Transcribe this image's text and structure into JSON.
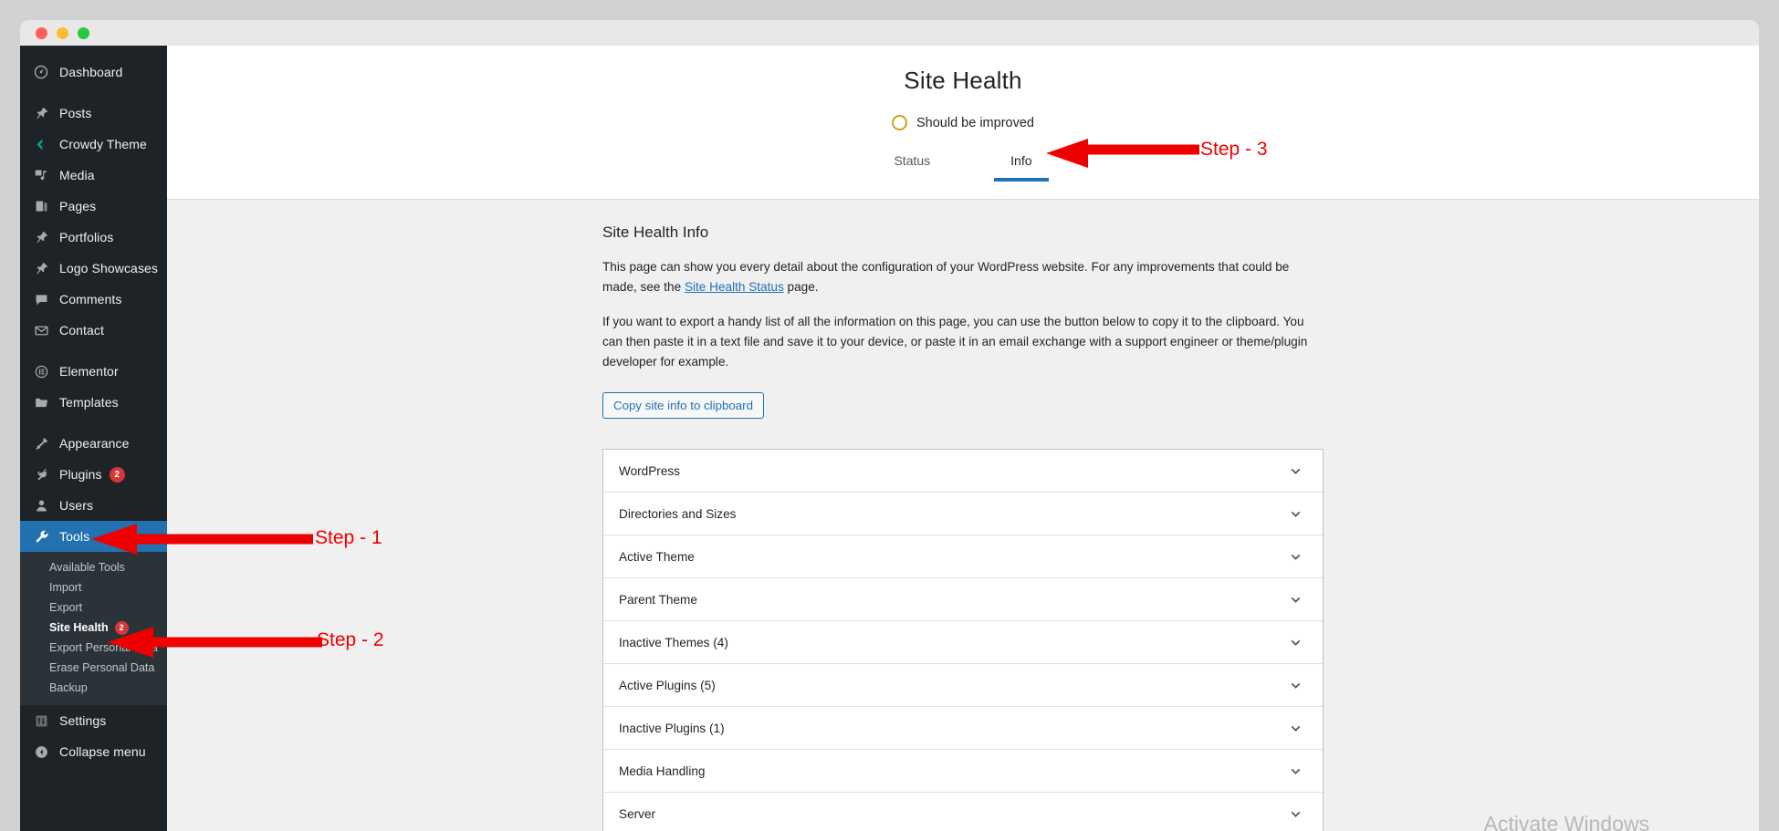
{
  "window": {
    "traffic_lights": [
      "close",
      "minimize",
      "maximize"
    ]
  },
  "sidebar": {
    "items": [
      {
        "label": "Dashboard",
        "icon": "dashboard-icon",
        "badge": null,
        "active": false,
        "spacer_before": false
      },
      {
        "label": "Posts",
        "icon": "pin-icon",
        "badge": null,
        "active": false,
        "spacer_before": true
      },
      {
        "label": "Crowdy Theme",
        "icon": "crowdy-theme-icon",
        "badge": null,
        "active": false,
        "spacer_before": false
      },
      {
        "label": "Media",
        "icon": "media-icon",
        "badge": null,
        "active": false,
        "spacer_before": false
      },
      {
        "label": "Pages",
        "icon": "pages-icon",
        "badge": null,
        "active": false,
        "spacer_before": false
      },
      {
        "label": "Portfolios",
        "icon": "pin-icon",
        "badge": null,
        "active": false,
        "spacer_before": false
      },
      {
        "label": "Logo Showcases",
        "icon": "pin-icon",
        "badge": null,
        "active": false,
        "spacer_before": false
      },
      {
        "label": "Comments",
        "icon": "comments-icon",
        "badge": null,
        "active": false,
        "spacer_before": false
      },
      {
        "label": "Contact",
        "icon": "envelope-icon",
        "badge": null,
        "active": false,
        "spacer_before": false
      },
      {
        "label": "Elementor",
        "icon": "elementor-icon",
        "badge": null,
        "active": false,
        "spacer_before": true
      },
      {
        "label": "Templates",
        "icon": "folder-icon",
        "badge": null,
        "active": false,
        "spacer_before": false
      },
      {
        "label": "Appearance",
        "icon": "appearance-icon",
        "badge": null,
        "active": false,
        "spacer_before": true
      },
      {
        "label": "Plugins",
        "icon": "plugins-icon",
        "badge": "2",
        "active": false,
        "spacer_before": false
      },
      {
        "label": "Users",
        "icon": "users-icon",
        "badge": null,
        "active": false,
        "spacer_before": false
      },
      {
        "label": "Tools",
        "icon": "tools-icon",
        "badge": null,
        "active": true,
        "spacer_before": false
      }
    ],
    "submenu": [
      {
        "label": "Available Tools",
        "current": false,
        "badge": null
      },
      {
        "label": "Import",
        "current": false,
        "badge": null
      },
      {
        "label": "Export",
        "current": false,
        "badge": null
      },
      {
        "label": "Site Health",
        "current": true,
        "badge": "2"
      },
      {
        "label": "Export Personal Data",
        "current": false,
        "badge": null
      },
      {
        "label": "Erase Personal Data",
        "current": false,
        "badge": null
      },
      {
        "label": "Backup",
        "current": false,
        "badge": null
      }
    ],
    "footer_items": [
      {
        "label": "Settings",
        "icon": "settings-icon"
      },
      {
        "label": "Collapse menu",
        "icon": "collapse-icon"
      }
    ]
  },
  "header": {
    "title": "Site Health",
    "status_label": "Should be improved",
    "status_ring_color": "#c9a227",
    "tabs": [
      {
        "label": "Status",
        "active": false
      },
      {
        "label": "Info",
        "active": true
      }
    ],
    "active_tab_color": "#2271b1"
  },
  "main": {
    "heading": "Site Health Info",
    "paragraph_1_before": "This page can show you every detail about the configuration of your WordPress website. For any improvements that could be made, see the ",
    "paragraph_1_link": "Site Health Status",
    "paragraph_1_after": " page.",
    "paragraph_2": "If you want to export a handy list of all the information on this page, you can use the button below to copy it to the clipboard. You can then paste it in a text file and save it to your device, or paste it in an email exchange with a support engineer or theme/plugin developer for example.",
    "copy_button": "Copy site info to clipboard",
    "accordion_rows": [
      {
        "label": "WordPress"
      },
      {
        "label": "Directories and Sizes"
      },
      {
        "label": "Active Theme"
      },
      {
        "label": "Parent Theme"
      },
      {
        "label": "Inactive Themes (4)"
      },
      {
        "label": "Active Plugins (5)"
      },
      {
        "label": "Inactive Plugins (1)"
      },
      {
        "label": "Media Handling"
      },
      {
        "label": "Server"
      }
    ]
  },
  "annotations": {
    "arrow_color": "#ee0000",
    "steps": [
      {
        "label": "Step - 1"
      },
      {
        "label": "Step - 2"
      },
      {
        "label": "Step - 3"
      }
    ]
  },
  "watermark": {
    "text": "Activate Windows"
  }
}
